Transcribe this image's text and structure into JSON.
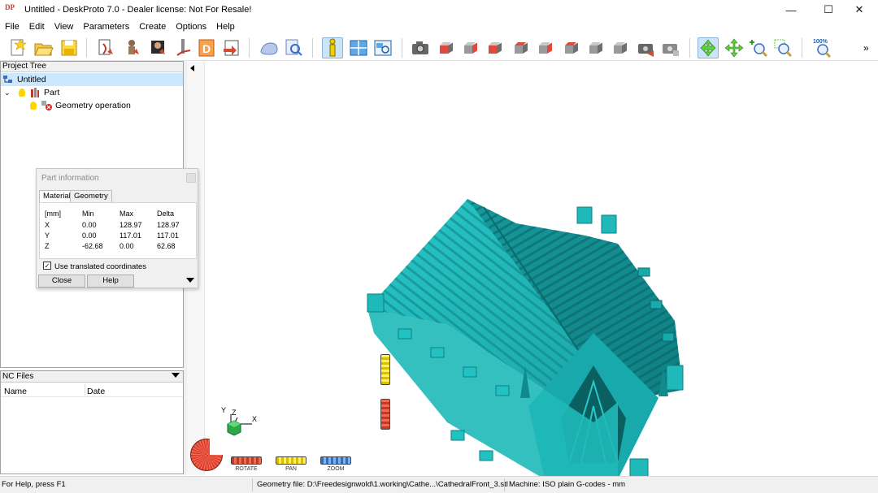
{
  "window": {
    "title": "Untitled - DeskProto 7.0 - Dealer license: Not For Resale!",
    "app_icon_text": "DP",
    "minimize_glyph": "—",
    "maximize_glyph": "☐",
    "close_glyph": "✕"
  },
  "menu": [
    "File",
    "Edit",
    "View",
    "Parameters",
    "Create",
    "Options",
    "Help"
  ],
  "toolbar": {
    "buttons": [
      "new-file-icon",
      "open-folder-icon",
      "save-icon",
      "import-geometry-icon",
      "import-vector-icon",
      "import-bitmap-icon",
      "drill-icon",
      "design-icon",
      "export-icon",
      "shading-icon",
      "zoom-search-icon",
      "info-icon",
      "layout-icon",
      "render-view-icon",
      "camera-icon",
      "view-front-icon",
      "view-back-icon",
      "view-left-icon",
      "view-right-icon",
      "view-top-icon",
      "view-bottom-icon",
      "view-iso-icon",
      "view-iso2-icon",
      "capture-icon",
      "capture2-icon",
      "rotate-mode-icon",
      "pan-mode-icon",
      "zoom-in-icon",
      "zoom-window-icon",
      "zoom-100-icon"
    ],
    "zoom_100_label": "100%",
    "overflow_glyph": "»"
  },
  "project_tree": {
    "header": "Project Tree",
    "items": [
      {
        "label": "Untitled",
        "level": 0,
        "selected": true
      },
      {
        "label": "Part",
        "level": 1,
        "expanded": true
      },
      {
        "label": "Geometry operation",
        "level": 2
      }
    ],
    "expand_glyph": "⌄"
  },
  "nc_files": {
    "header": "NC Files",
    "columns": [
      "Name",
      "Date"
    ]
  },
  "part_information": {
    "title": "Part information",
    "tabs": [
      "Material",
      "Geometry"
    ],
    "active_tab": "Material",
    "columns": [
      "[mm]",
      "Min",
      "Max",
      "Delta"
    ],
    "rows": [
      {
        "axis": "X",
        "min": "0.00",
        "max": "128.97",
        "delta": "128.97"
      },
      {
        "axis": "Y",
        "min": "0.00",
        "max": "117.01",
        "delta": "117.01"
      },
      {
        "axis": "Z",
        "min": "-62.68",
        "max": "0.00",
        "delta": "62.68"
      }
    ],
    "use_translated_label": "Use translated coordinates",
    "use_translated_checked": true,
    "close_button": "Close",
    "help_button": "Help"
  },
  "viewport": {
    "model_color": "#1fb9b9",
    "axis_labels": {
      "x": "X",
      "y": "Y",
      "z": "Z"
    },
    "controls": {
      "rotate": "ROTATE",
      "pan": "PAN",
      "zoom": "ZOOM"
    }
  },
  "status_bar": {
    "help": "For Help, press F1",
    "geometry_file": "Geometry file: D:\\Freedesignwold\\1.working\\Cathe...\\CathedralFront_3.stl",
    "machine": "Machine: ISO plain G-codes - mm"
  }
}
